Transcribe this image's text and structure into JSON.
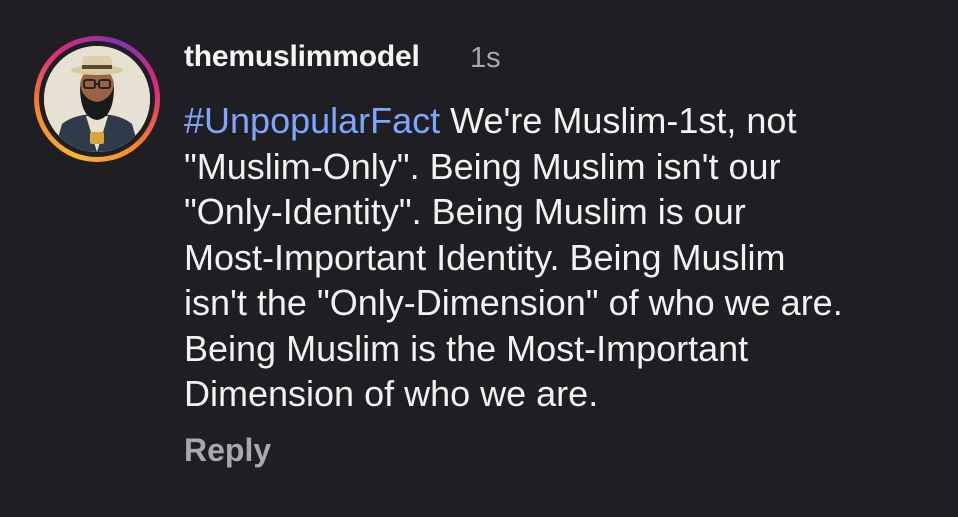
{
  "comment": {
    "username": "themuslimmodel",
    "timestamp": "1s",
    "hashtag": "#UnpopularFact",
    "text_lines": [
      " We're Muslim-1st, not",
      "\"Muslim-Only\". Being Muslim isn't our",
      "\"Only-Identity\". Being Muslim is our",
      "Most-Important Identity. Being Muslim",
      "isn't the \"Only-Dimension\" of who we are.",
      "Being Muslim is the Most-Important",
      "Dimension of who we are."
    ],
    "reply_label": "Reply",
    "avatar_icon": "cartoon-man-avatar",
    "colors": {
      "background": "#1f1f23",
      "hashtag": "#7fa6ff",
      "muted": "#a8a8ae",
      "ring_start": "#f7b733",
      "ring_end": "#dd2a7b"
    }
  }
}
